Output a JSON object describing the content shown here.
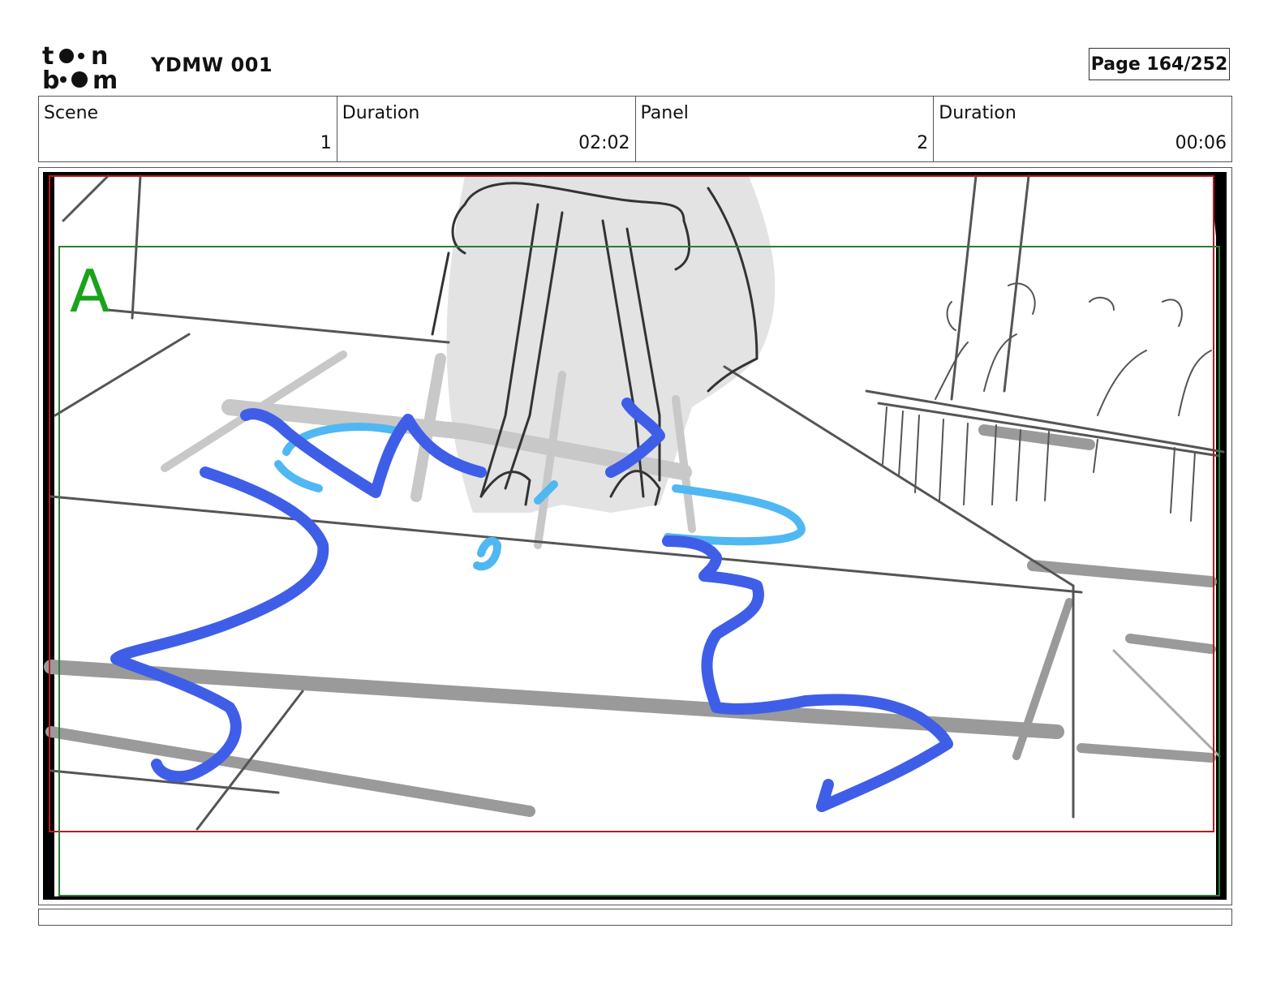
{
  "header": {
    "logo_text": "toon boom",
    "project_title": "YDMW 001",
    "page_label": "Page 164/252"
  },
  "info": {
    "scene_label": "Scene",
    "scene_value": "1",
    "scene_duration_label": "Duration",
    "scene_duration_value": "02:02",
    "panel_label": "Panel",
    "panel_value": "2",
    "panel_duration_label": "Duration",
    "panel_duration_value": "00:06"
  },
  "panel": {
    "marker_letter": "A",
    "colors": {
      "camera_frame": "#2e7d32",
      "safe_frame": "#b71c1c",
      "motion_path": "#3f5ee8",
      "splash": "#4fb8f2",
      "sketch": "#555555"
    }
  },
  "caption": ""
}
